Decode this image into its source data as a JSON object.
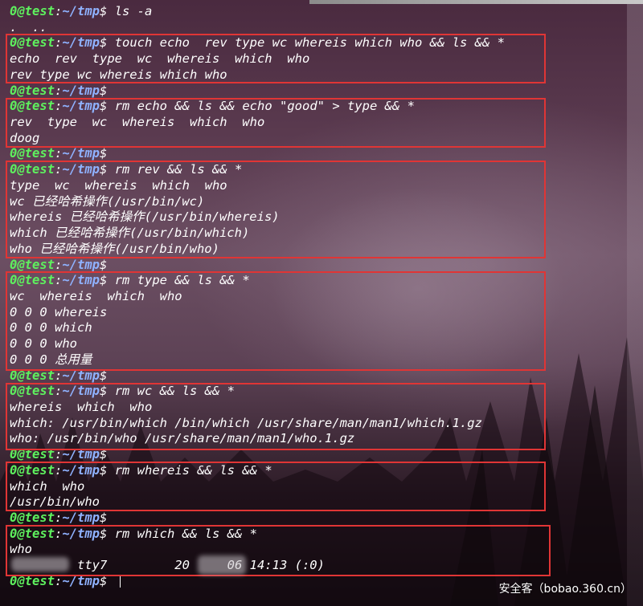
{
  "prompt": {
    "user": "0@test",
    "colon": ":",
    "path": "~/tmp",
    "dollar": "$"
  },
  "lines": [
    {
      "type": "prompt",
      "cmd": " ls -a"
    },
    {
      "type": "output",
      "text": ".  .."
    },
    {
      "type": "prompt",
      "cmd": " touch echo  rev type wc whereis which who && ls && *"
    },
    {
      "type": "output",
      "text": "echo  rev  type  wc  whereis  which  who"
    },
    {
      "type": "output",
      "text": "rev type wc whereis which who"
    },
    {
      "type": "prompt",
      "cmd": ""
    },
    {
      "type": "prompt",
      "cmd": " rm echo && ls && echo \"good\" > type && *"
    },
    {
      "type": "output",
      "text": "rev  type  wc  whereis  which  who"
    },
    {
      "type": "output",
      "text": "doog"
    },
    {
      "type": "prompt",
      "cmd": ""
    },
    {
      "type": "prompt",
      "cmd": " rm rev && ls && *"
    },
    {
      "type": "output",
      "text": "type  wc  whereis  which  who"
    },
    {
      "type": "output",
      "text": "wc 已经哈希操作(/usr/bin/wc)"
    },
    {
      "type": "output",
      "text": "whereis 已经哈希操作(/usr/bin/whereis)"
    },
    {
      "type": "output",
      "text": "which 已经哈希操作(/usr/bin/which)"
    },
    {
      "type": "output",
      "text": "who 已经哈希操作(/usr/bin/who)"
    },
    {
      "type": "prompt",
      "cmd": ""
    },
    {
      "type": "prompt",
      "cmd": " rm type && ls && *"
    },
    {
      "type": "output",
      "text": "wc  whereis  which  who"
    },
    {
      "type": "output",
      "text": "0 0 0 whereis"
    },
    {
      "type": "output",
      "text": "0 0 0 which"
    },
    {
      "type": "output",
      "text": "0 0 0 who"
    },
    {
      "type": "output",
      "text": "0 0 0 总用量"
    },
    {
      "type": "prompt",
      "cmd": ""
    },
    {
      "type": "prompt",
      "cmd": " rm wc && ls && *"
    },
    {
      "type": "output",
      "text": "whereis  which  who"
    },
    {
      "type": "output",
      "text": "which: /usr/bin/which /bin/which /usr/share/man/man1/which.1.gz"
    },
    {
      "type": "output",
      "text": "who: /usr/bin/who /usr/share/man/man1/who.1.gz"
    },
    {
      "type": "prompt",
      "cmd": ""
    },
    {
      "type": "prompt",
      "cmd": " rm whereis && ls && *"
    },
    {
      "type": "output",
      "text": "which  who"
    },
    {
      "type": "output",
      "text": "/usr/bin/who"
    },
    {
      "type": "prompt",
      "cmd": ""
    },
    {
      "type": "prompt",
      "cmd": " rm which && ls && *"
    },
    {
      "type": "output",
      "text": "who"
    },
    {
      "type": "output",
      "text": "         tty7         20     06 14:13 (:0)"
    },
    {
      "type": "prompt",
      "cmd": " "
    }
  ],
  "watermark": "安全客（bobao.360.cn）",
  "colors": {
    "user": "#5ef05e",
    "path": "#8fb2ff",
    "text": "#ffffff",
    "highlight_box": "#e03535"
  }
}
